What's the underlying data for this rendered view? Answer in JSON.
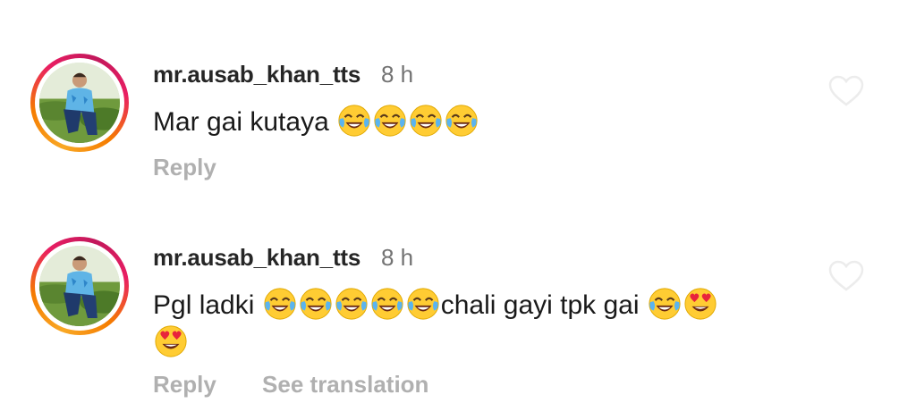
{
  "comments": [
    {
      "username": "mr.ausab_khan_tts",
      "time": "8 h",
      "text_parts": [
        "Mar gai kutaya "
      ],
      "emojis": [
        "face-with-tears-of-joy",
        "face-with-tears-of-joy",
        "face-with-tears-of-joy",
        "face-with-tears-of-joy"
      ],
      "reply_label": "Reply",
      "like_icon": "heart-outline-icon"
    },
    {
      "username": "mr.ausab_khan_tts",
      "time": "8 h",
      "text_part_1": "Pgl ladki ",
      "text_part_2": "chali gayi tpk gai ",
      "emojis": [
        "face-with-tears-of-joy",
        "face-with-tears-of-joy",
        "face-with-tears-of-joy",
        "face-with-tears-of-joy",
        "face-with-tears-of-joy",
        "face-with-tears-of-joy",
        "smiling-face-with-heart-eyes",
        "smiling-face-with-heart-eyes"
      ],
      "reply_label": "Reply",
      "translation_label": "See translation",
      "like_icon": "heart-outline-icon"
    }
  ],
  "colors": {
    "username": "#262626",
    "time": "#737373",
    "action": "#b0b0b0",
    "ring_start": "#f9a825",
    "ring_end": "#e91e63"
  }
}
